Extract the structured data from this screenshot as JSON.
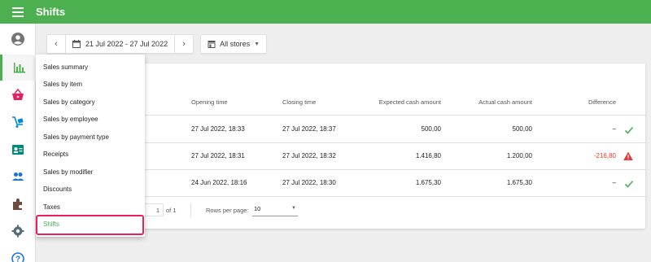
{
  "header": {
    "title": "Shifts"
  },
  "toolbar": {
    "date_range": "21 Jul 2022 - 27 Jul 2022",
    "store_filter": "All stores"
  },
  "table": {
    "columns": [
      "Opening time",
      "Closing time",
      "Expected cash amount",
      "Actual cash amount",
      "Difference"
    ],
    "rows": [
      {
        "opening": "27 Jul 2022, 18:33",
        "closing": "27 Jul 2022, 18:37",
        "expected": "500,00",
        "actual": "500,00",
        "difference": "–",
        "status": "check-icon"
      },
      {
        "opening": "27 Jul 2022, 18:31",
        "closing": "27 Jul 2022, 18:32",
        "expected": "1.416,80",
        "actual": "1.200,00",
        "difference": "-216,80",
        "status": "warning-icon"
      },
      {
        "opening": "24 Jun 2022, 18:16",
        "closing": "27 Jul 2022, 18:30",
        "expected": "1.675,30",
        "actual": "1.675,30",
        "difference": "–",
        "status": "check-icon"
      }
    ]
  },
  "pagination": {
    "page_value": "1",
    "of_label": "of 1",
    "rows_per_page_label": "Rows per page:",
    "rows_per_page_value": "10"
  },
  "menu": {
    "items": [
      "Sales summary",
      "Sales by item",
      "Sales by category",
      "Sales by employee",
      "Sales by payment type",
      "Receipts",
      "Sales by modifier",
      "Discounts",
      "Taxes",
      "Shifts"
    ],
    "active_index": 9
  },
  "colors": {
    "brand": "#4caf50",
    "negative": "#e53935",
    "highlight": "#e91e63"
  }
}
